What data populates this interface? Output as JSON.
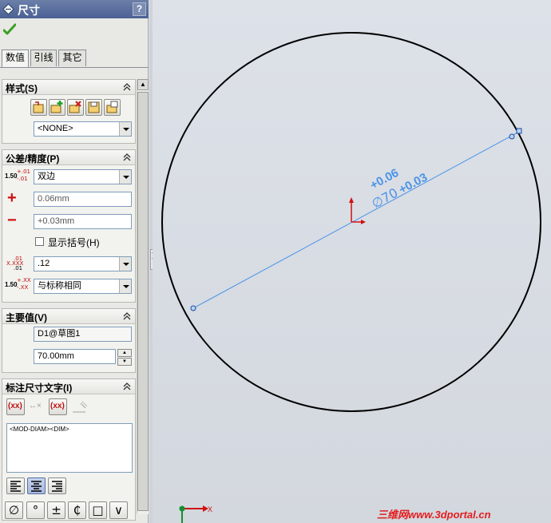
{
  "panel": {
    "title": "尺寸",
    "help": "?",
    "tabs": [
      "数值",
      "引线",
      "其它"
    ]
  },
  "style_group": {
    "header": "样式(S)",
    "style_combo": "<NONE>"
  },
  "tolerance_group": {
    "header": "公差/精度(P)",
    "tol_icon_label": "1.50",
    "tol_icon_upper": "+.01",
    "tol_icon_lower": "-.01",
    "tolerance_type": "双边",
    "plus_sign": "+",
    "minus_sign": "−",
    "upper_value": "0.06mm",
    "lower_value": "+0.03mm",
    "show_parens_label": "显示括号(H)",
    "show_parens_checked": false,
    "prec_icon_top": ".01",
    "prec_icon_mid": "X.XXX",
    "prec_icon_bot": ".01",
    "unit_precision": ".12",
    "tol_prec_icon_label": "1.50",
    "tol_prec_icon_top": "+.XX",
    "tol_prec_icon_bot": "-.XX",
    "tolerance_precision": "与标称相同"
  },
  "primary_group": {
    "header": "主要值(V)",
    "name_value": "D1@草图1",
    "dim_value": "70.00mm"
  },
  "dimtext_group": {
    "header": "标注尺寸文字(I)",
    "paren_btn": "(xx)",
    "arrow_btn": "↔×",
    "inspect_btn": "(xx)",
    "text_value": "<MOD-DIAM><DIM>"
  },
  "symbols": [
    "∅",
    "°",
    "±",
    "₵",
    "□",
    "∨"
  ],
  "drawing": {
    "dim_upper": "+0.06",
    "dim_diameter": "∅70",
    "dim_lower": "+0.03",
    "axis_x": "X",
    "watermark": "三维网www.3dportal.cn",
    "colors": {
      "circle": "#000000",
      "dimension": "#3a8ce8",
      "origin_red": "#d01010",
      "origin_green": "#109030"
    }
  }
}
